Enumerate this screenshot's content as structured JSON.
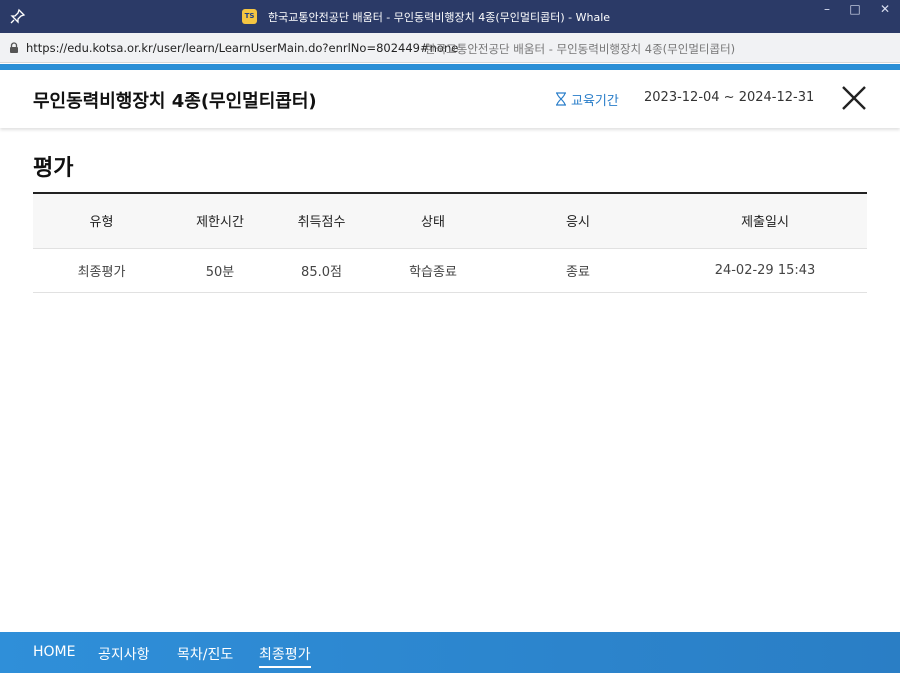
{
  "window": {
    "title": "한국교통안전공단 배움터 - 무인동력비행장치 4종(무인멀티콥터) - Whale",
    "app_icon_text": "TS",
    "controls": [
      "minimize-icon",
      "maximize-icon",
      "close-icon"
    ]
  },
  "address_bar": {
    "url": "https://edu.kotsa.or.kr/user/learn/LearnUserMain.do?enrlNo=802449#none",
    "page_title": "한국교통안전공단 배움터 - 무인동력비행장치 4종(무인멀티콥터)"
  },
  "header": {
    "course_title": "무인동력비행장치 4종(무인멀티콥터)",
    "period_label": "교육기간",
    "period_value": "2023-12-04 ~ 2024-12-31",
    "accent_color": "#2a8fd6"
  },
  "main": {
    "section_title": "평가",
    "table": {
      "columns": [
        "유형",
        "제한시간",
        "취득점수",
        "상태",
        "응시",
        "제출일시"
      ],
      "rows": [
        [
          "최종평가",
          "50분",
          "85.0점",
          "학습종료",
          "종료",
          "24-02-29 15:43"
        ]
      ]
    }
  },
  "bottom_nav": {
    "items": [
      "HOME",
      "공지사항",
      "목차/진도",
      "최종평가"
    ],
    "active": "최종평가"
  }
}
